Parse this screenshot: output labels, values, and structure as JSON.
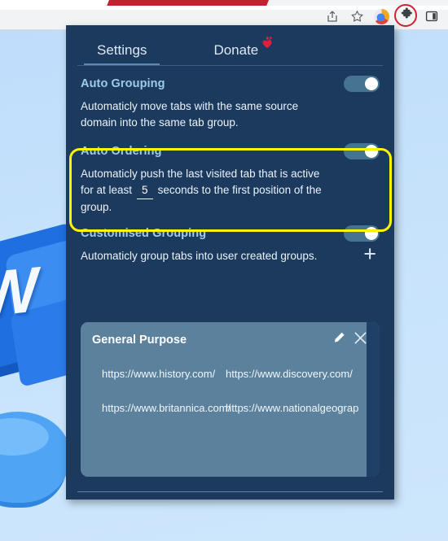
{
  "browser": {
    "toolbar_icons": [
      {
        "name": "share-icon",
        "label": "Share this page"
      },
      {
        "name": "bookmark-star-icon",
        "label": "Bookmark this tab"
      },
      {
        "name": "profile-circle-icon",
        "label": "Profile"
      },
      {
        "name": "extensions-puzzle-icon",
        "label": "Extensions"
      },
      {
        "name": "sidebar-toggle-icon",
        "label": "Sidebar"
      }
    ],
    "annotation_color": "#cf2233",
    "red_bar_color": "#c4202e"
  },
  "popup": {
    "tabs": [
      {
        "id": "settings",
        "label": "Settings",
        "active": true
      },
      {
        "id": "donate",
        "label": "Donate",
        "active": false,
        "icon": "heart-icon"
      }
    ],
    "sections": [
      {
        "id": "auto-grouping",
        "title": "Auto Grouping",
        "description": "Automaticly move tabs with the same source domain into the same tab group.",
        "toggle_on": true,
        "highlighted": false
      },
      {
        "id": "auto-ordering",
        "title": "Auto Ordering",
        "description_before": "Automaticly push the last visited tab that is active for at least",
        "seconds_value": "5",
        "description_after": "seconds to the first position of the group.",
        "toggle_on": true,
        "highlighted": true
      },
      {
        "id": "customised-grouping",
        "title": "Customised Grouping",
        "description": "Automaticly group tabs into user created groups.",
        "toggle_on": true,
        "add_label": "+",
        "highlighted": false
      }
    ],
    "group_card": {
      "title": "General Purpose",
      "edit_icon": "pencil-icon",
      "close_icon": "close-icon",
      "urls": [
        "https://www.history.com/",
        "https://www.discovery.com/",
        "https://www.britannica.com/",
        "https://www.nationalgeograp"
      ]
    },
    "colors": {
      "panel_bg": "#1c3a5e",
      "title": "#9ecbe8",
      "toggle_track": "#46738f",
      "card_bg": "#5c819c",
      "highlight": "#fbf500"
    }
  }
}
